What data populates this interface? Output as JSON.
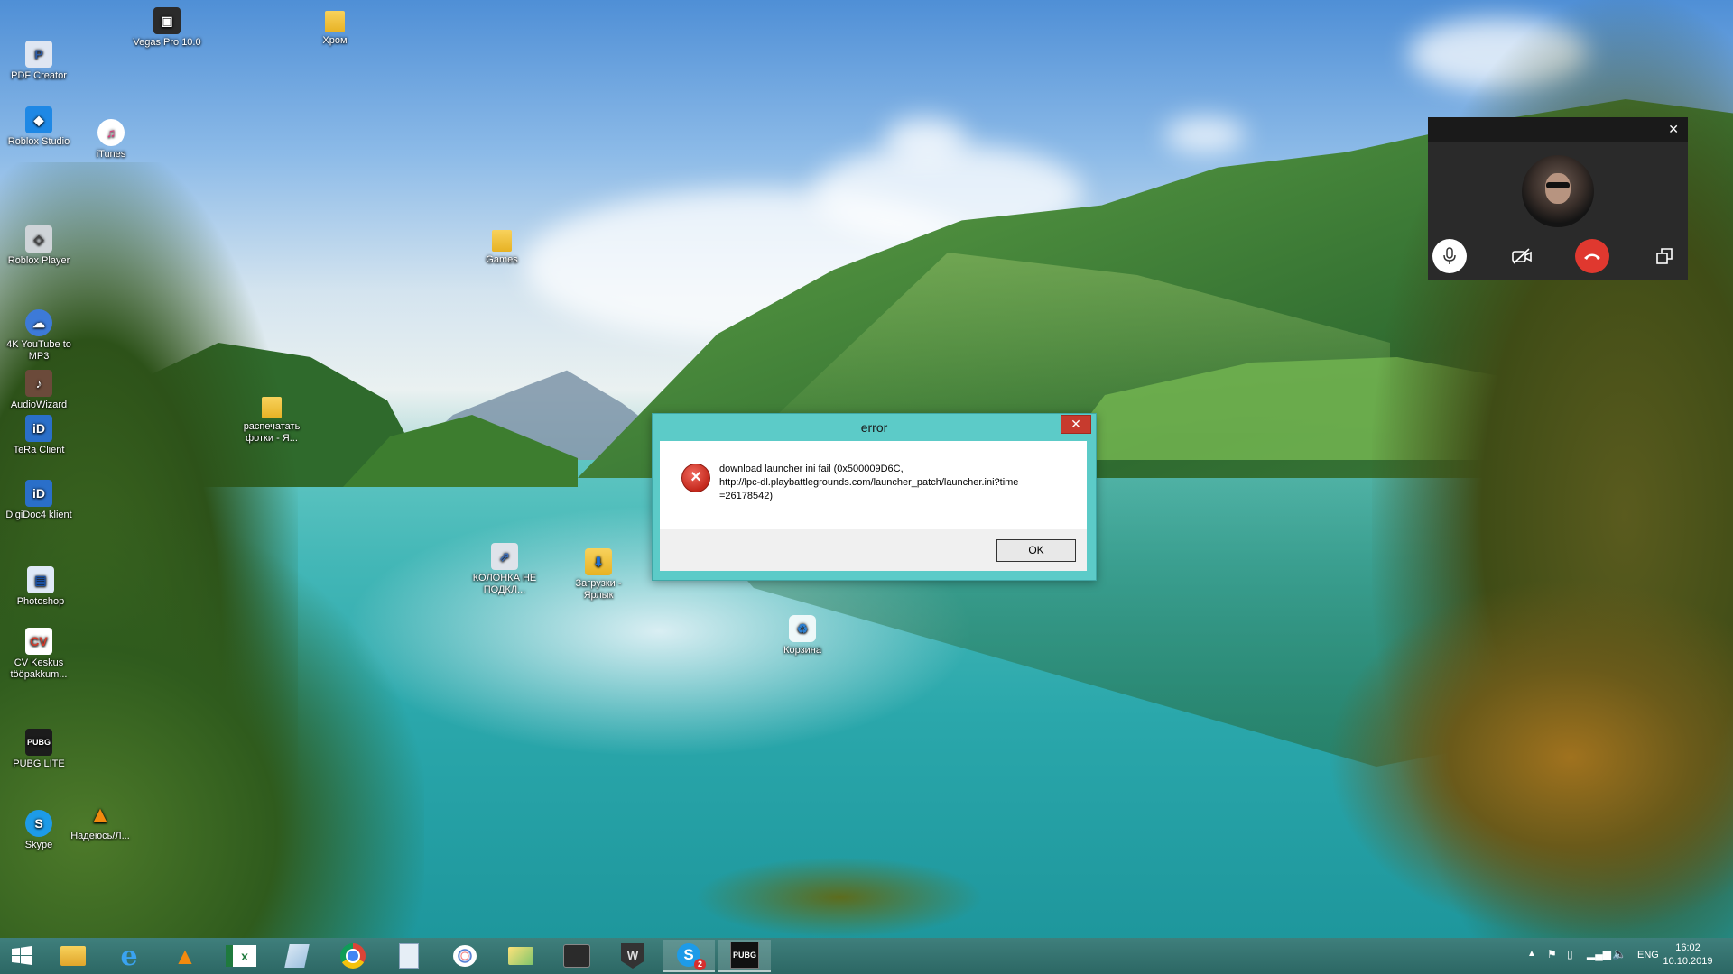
{
  "desktop": {
    "icons": [
      {
        "label": "PDF Creator"
      },
      {
        "label": "Vegas Pro 10.0"
      },
      {
        "label": "Хром"
      },
      {
        "label": "Roblox Studio"
      },
      {
        "label": "iTunes"
      },
      {
        "label": "Roblox Player"
      },
      {
        "label": "Games"
      },
      {
        "label": "4K YouTube to MP3"
      },
      {
        "label": "AudioWizard"
      },
      {
        "label": "распечатать фотки - Я..."
      },
      {
        "label": "TeRa Client"
      },
      {
        "label": "DigiDoc4 klient"
      },
      {
        "label": "КОЛОНКА НЕ ПОДКЛ..."
      },
      {
        "label": "Загрузки - Ярлык"
      },
      {
        "label": "Photoshop"
      },
      {
        "label": "Корзина"
      },
      {
        "label": "CV Keskus tööpakkum..."
      },
      {
        "label": "PUBG LITE"
      },
      {
        "label": "Skype"
      },
      {
        "label": "Надеюсь/Л..."
      }
    ]
  },
  "dialog": {
    "title": "error",
    "close": "✕",
    "message_line1": "download launcher ini fail (0x500009D6C,",
    "message_line2": "http://lpc-dl.playbattlegrounds.com/launcher_patch/launcher.ini?time",
    "message_line3": "=26178542)",
    "ok_label": "OK",
    "icon": "error-x-icon",
    "accent": "#5ccbc8"
  },
  "call": {
    "close": "✕",
    "hangup_color": "#e0382f"
  },
  "taskbar": {
    "skype_badge": "2",
    "tray": {
      "lang": "ENG",
      "time": "16:02",
      "date": "10.10.2019"
    }
  }
}
